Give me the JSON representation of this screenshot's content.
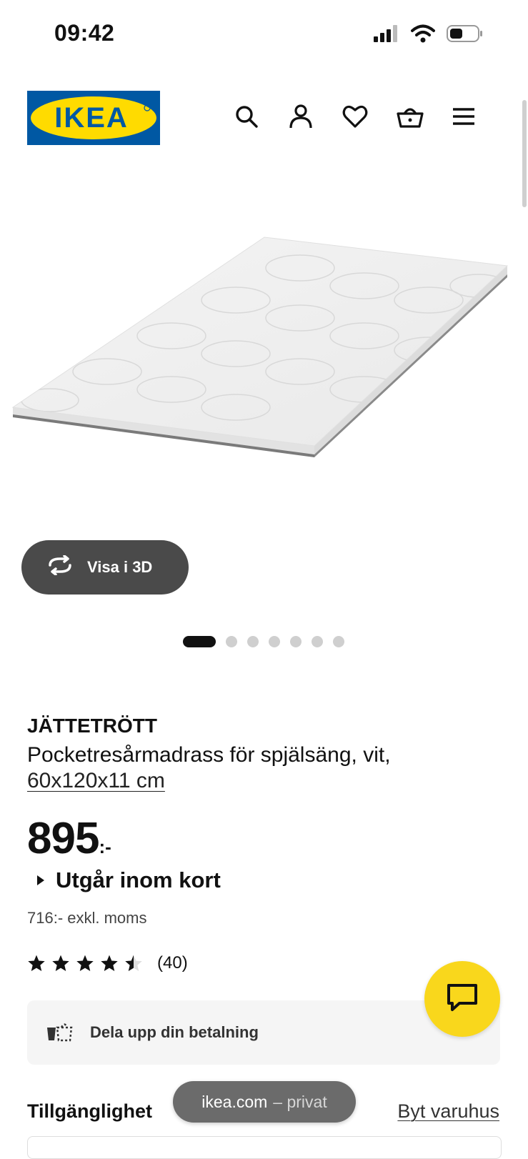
{
  "status_bar": {
    "time": "09:42"
  },
  "brand": {
    "logo_text": "IKEA",
    "blue": "#0058a3",
    "yellow": "#ffdb00"
  },
  "header": {
    "icons": [
      "search-icon",
      "profile-icon",
      "heart-icon",
      "basket-icon",
      "menu-icon"
    ]
  },
  "gallery": {
    "view_3d_label": "Visa i 3D",
    "image_count": 7,
    "active_index": 0
  },
  "product": {
    "name": "JÄTTETRÖTT",
    "description": "Pocketresårmadrass för spjälsäng, vit,",
    "size": "60x120x11 cm",
    "price_amount": "895",
    "price_suffix": ":-",
    "stock_status": "Utgår inom kort",
    "price_excl_vat": "716:- exkl. moms",
    "rating_value": 4.5,
    "rating_count": "(40)"
  },
  "payment": {
    "label": "Dela upp din betalning"
  },
  "availability": {
    "title": "Tillgänglighet",
    "change_store": "Byt varuhus"
  },
  "browser": {
    "domain": "ikea.com",
    "mode": "– privat"
  },
  "colors": {
    "chat_fab": "#f9d71c",
    "dark_button": "#4a4a4a"
  }
}
